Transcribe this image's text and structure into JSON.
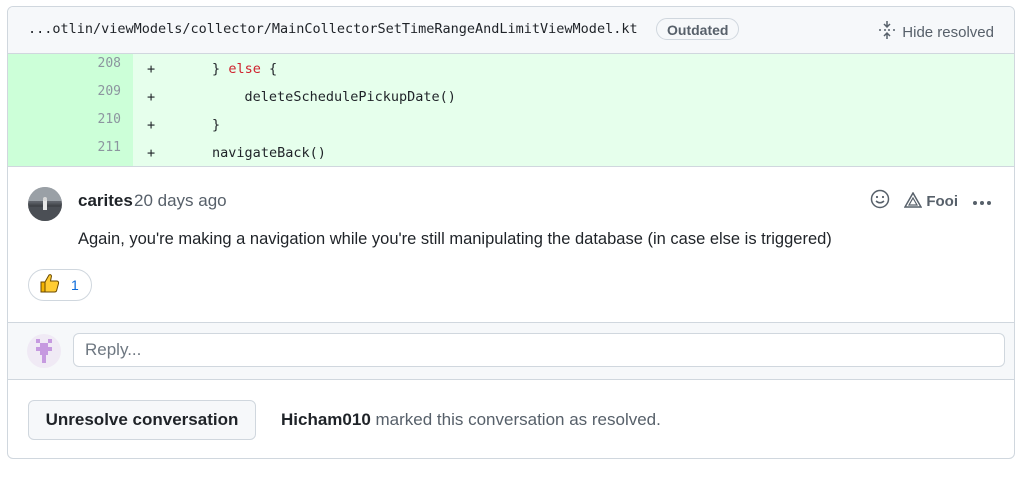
{
  "file": {
    "path": "...otlin/viewModels/collector/MainCollectorSetTimeRangeAndLimitViewModel.kt",
    "badge": "Outdated",
    "hide_resolved_label": "Hide resolved"
  },
  "diff": [
    {
      "line": "208",
      "marker": "+",
      "indent": "       ",
      "pre": "} ",
      "kw": "else",
      "post": " {"
    },
    {
      "line": "209",
      "marker": "+",
      "indent": "           ",
      "pre": "deleteSchedulePickupDate()",
      "kw": "",
      "post": ""
    },
    {
      "line": "210",
      "marker": "+",
      "indent": "       ",
      "pre": "}",
      "kw": "",
      "post": ""
    },
    {
      "line": "211",
      "marker": "+",
      "indent": "       ",
      "pre": "navigateBack()",
      "kw": "",
      "post": ""
    }
  ],
  "comment": {
    "author": "carites",
    "time": "20 days ago",
    "foo_label": "Fooi",
    "body": "Again, you're making a navigation while you're still manipulating the database (in case else is triggered)",
    "reaction_count": "1"
  },
  "reply": {
    "placeholder": "Reply..."
  },
  "resolved": {
    "button_label": "Unresolve conversation",
    "user": "Hicham010",
    "message": " marked this conversation as resolved."
  },
  "colors": {
    "diff_bg": "#e6ffec",
    "line_number_bg": "#ccffd8",
    "keyword": "#cf222e",
    "link": "#0969da"
  }
}
